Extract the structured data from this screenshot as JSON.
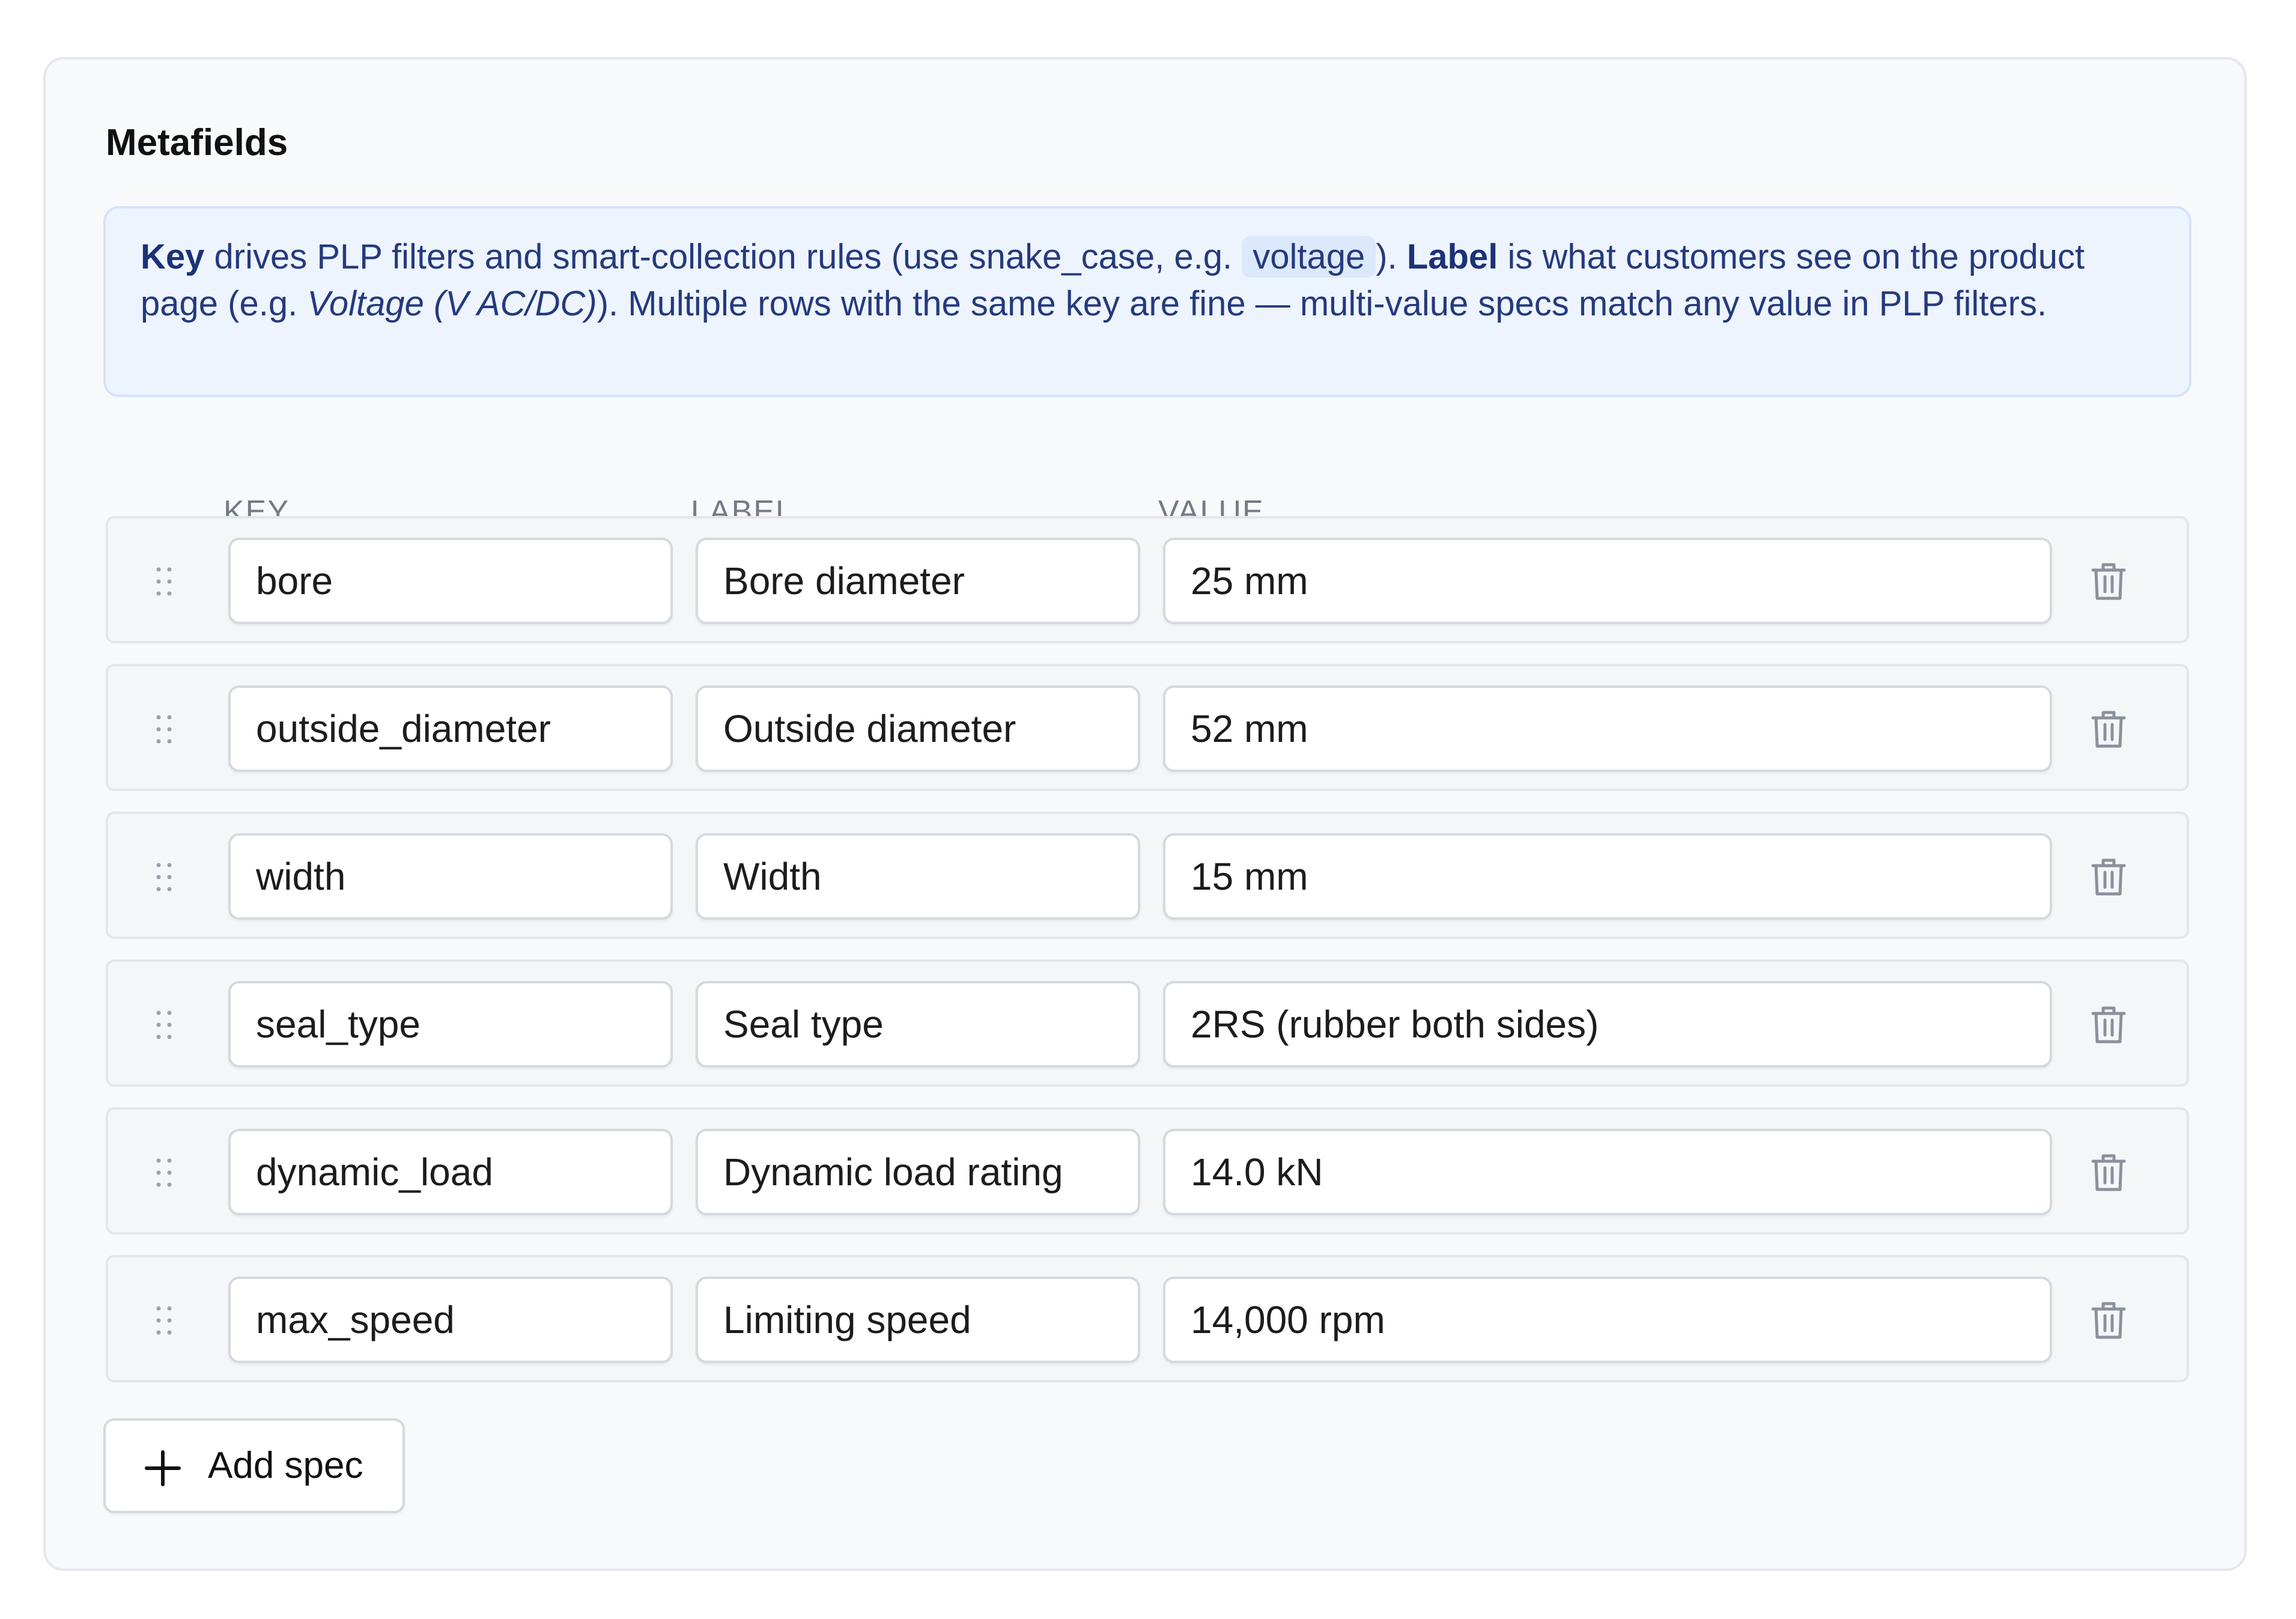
{
  "section": {
    "title": "Metafields"
  },
  "info": {
    "key_term": "Key",
    "text_1": " drives PLP filters and smart-collection rules (use snake_case, e.g. ",
    "code_example": "voltage",
    "text_2": "). ",
    "label_term": "Label",
    "text_3": " is what customers see on the product page (e.g. ",
    "italic_example": "Voltage (V AC/DC)",
    "text_4": "). Multiple rows with the same key are fine — multi-value specs match any value in PLP filters."
  },
  "columns": {
    "key": "KEY",
    "label": "LABEL",
    "value": "VALUE"
  },
  "rows": [
    {
      "key": "bore",
      "label": "Bore diameter",
      "value": "25 mm"
    },
    {
      "key": "outside_diameter",
      "label": "Outside diameter",
      "value": "52 mm"
    },
    {
      "key": "width",
      "label": "Width",
      "value": "15 mm"
    },
    {
      "key": "seal_type",
      "label": "Seal type",
      "value": "2RS (rubber both sides)"
    },
    {
      "key": "dynamic_load",
      "label": "Dynamic load rating",
      "value": "14.0 kN"
    },
    {
      "key": "max_speed",
      "label": "Limiting speed",
      "value": "14,000 rpm"
    }
  ],
  "add_button": {
    "label": "Add spec",
    "icon": "plus-icon"
  },
  "icons": {
    "drag": "drag-handle-icon",
    "delete": "trash-icon"
  },
  "colors": {
    "info_background": "#edf4fe",
    "info_text": "#253a7d",
    "panel_background": "#f8f9fb"
  }
}
